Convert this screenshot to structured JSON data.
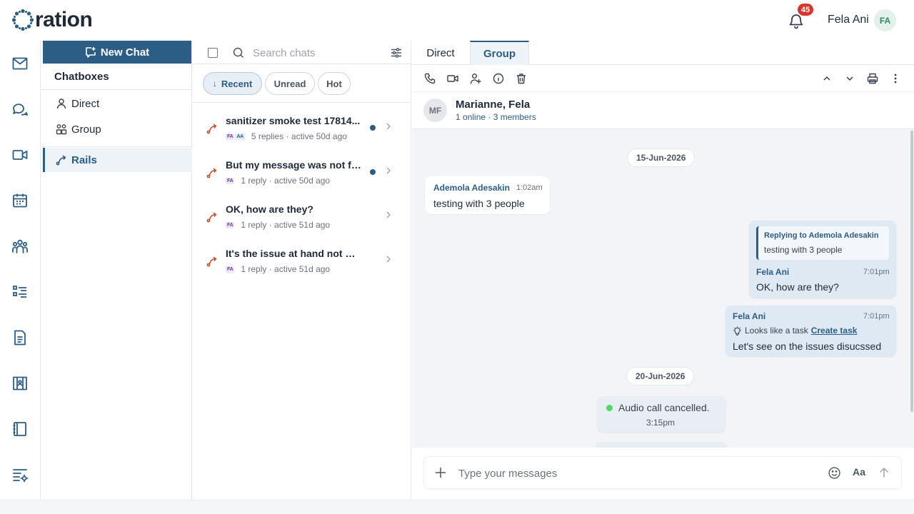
{
  "app": {
    "logo_text": "ration"
  },
  "topbar": {
    "notification_count": "45",
    "user_name": "Fela Ani",
    "user_initials": "FA"
  },
  "sidebar": {
    "new_chat_label": "New Chat",
    "title": "Chatboxes",
    "items": [
      {
        "label": "Direct",
        "icon": "user-icon"
      },
      {
        "label": "Group",
        "icon": "group-icon"
      },
      {
        "label": "Rails",
        "icon": "rail-icon",
        "active": true
      }
    ]
  },
  "chat_list": {
    "search_placeholder": "Search chats",
    "filters": [
      {
        "label": "Recent",
        "active": true
      },
      {
        "label": "Unread"
      },
      {
        "label": "Hot"
      }
    ],
    "threads": [
      {
        "title": "sanitizer smoke test 17814...",
        "avatars": [
          "FA",
          "AA"
        ],
        "meta": "5 replies · active 50d ago",
        "unread": true
      },
      {
        "title": "But my message was not fo...",
        "avatars": [
          "FA"
        ],
        "meta": "1 reply · active 50d ago",
        "unread": true
      },
      {
        "title": "OK, how are they?",
        "avatars": [
          "FA"
        ],
        "meta": "1 reply · active 51d ago",
        "unread": false
      },
      {
        "title": "It's the issue at hand not wort...",
        "avatars": [
          "FA"
        ],
        "meta": "1 reply · active 51d ago",
        "unread": false
      }
    ]
  },
  "conversation": {
    "tabs": [
      {
        "label": "Direct"
      },
      {
        "label": "Group",
        "active": true
      }
    ],
    "header": {
      "initials": "MF",
      "name": "Marianne, Fela",
      "subtitle": "1 online · 3 members"
    },
    "dates": [
      "15-Jun-2026",
      "20-Jun-2026"
    ],
    "messages": [
      {
        "sender": "Ademola Adesakin",
        "time": "1:02am",
        "text": "testing with 3 people"
      },
      {
        "reply_label": "Replying to Ademola Adesakin",
        "reply_text": "testing with 3 people",
        "sender": "Fela Ani",
        "time": "7:01pm",
        "text": "OK, how are they?"
      },
      {
        "sender": "Fela Ani",
        "time": "7:01pm",
        "task_hint": "Looks like a task",
        "task_link": "Create task",
        "text": "Let's see on the issues disucssed"
      }
    ],
    "call": {
      "text": "Audio call cancelled.",
      "time": "3:15pm",
      "status_color": "#4cd964"
    },
    "composer": {
      "placeholder": "Type your messages",
      "format_label": "Aa"
    }
  },
  "colors": {
    "brand": "#2c5d85",
    "badge": "#d9362b",
    "rail_accent": "#c0502d"
  }
}
